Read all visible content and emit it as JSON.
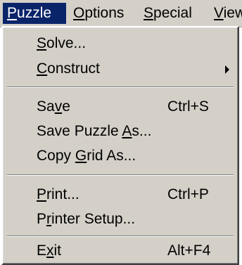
{
  "menubar": {
    "items": [
      {
        "label": "Puzzle",
        "mnemonic_index": 0,
        "active": true
      },
      {
        "label": "Options",
        "mnemonic_index": 0,
        "active": false
      },
      {
        "label": "Special",
        "mnemonic_index": 0,
        "active": false
      },
      {
        "label": "View",
        "mnemonic_index": 0,
        "active": false
      }
    ]
  },
  "puzzle_menu": {
    "items": [
      {
        "label": "Solve...",
        "mnemonic_index": 0,
        "shortcut": ""
      },
      {
        "label": "Construct",
        "mnemonic_index": 0,
        "shortcut": "",
        "has_submenu": true
      },
      {
        "label": "Save",
        "mnemonic_index": 2,
        "shortcut": "Ctrl+S"
      },
      {
        "label": "Save Puzzle As...",
        "mnemonic_index": 12,
        "shortcut": ""
      },
      {
        "label": "Copy Grid As...",
        "mnemonic_index": 5,
        "shortcut": ""
      },
      {
        "label": "Print...",
        "mnemonic_index": 0,
        "shortcut": "Ctrl+P"
      },
      {
        "label": "Printer Setup...",
        "mnemonic_index": 1,
        "shortcut": ""
      },
      {
        "label": "Exit",
        "mnemonic_index": 1,
        "shortcut": "Alt+F4"
      }
    ]
  },
  "colors": {
    "menu_background": "#d4d0c8",
    "highlight_background": "#0a246a",
    "highlight_text": "#ffffff",
    "text": "#000000"
  }
}
